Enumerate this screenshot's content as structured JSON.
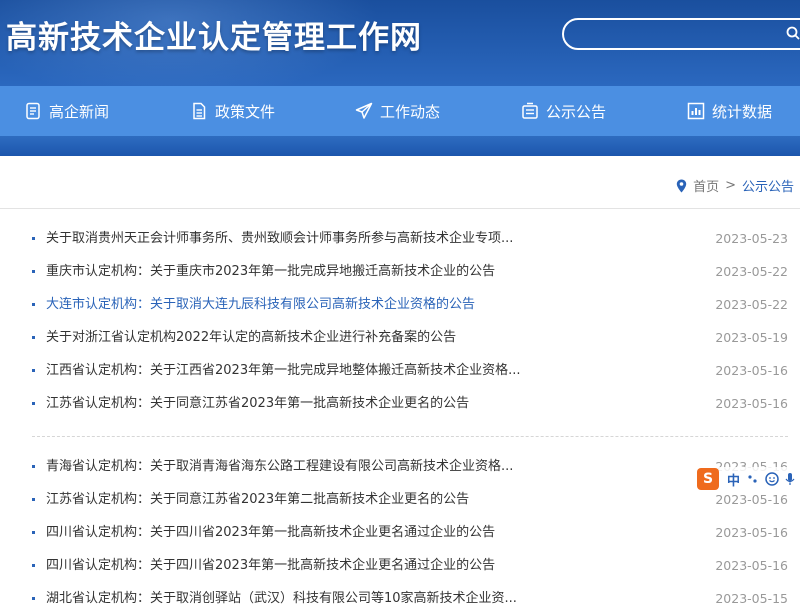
{
  "header": {
    "site_title": "高新技术企业认定管理工作网",
    "search_placeholder": ""
  },
  "nav": [
    {
      "label": "高企新闻",
      "icon": "document-icon"
    },
    {
      "label": "政策文件",
      "icon": "file-list-icon"
    },
    {
      "label": "工作动态",
      "icon": "paper-plane-icon"
    },
    {
      "label": "公示公告",
      "icon": "notice-board-icon"
    },
    {
      "label": "统计数据",
      "icon": "bar-chart-icon"
    }
  ],
  "breadcrumb": {
    "home": "首页",
    "separator": ">",
    "current": "公示公告"
  },
  "notices_group1": [
    {
      "title": "关于取消贵州天正会计师事务所、贵州致顺会计师事务所参与高新技术企业专项...",
      "date": "2023-05-23"
    },
    {
      "title": "重庆市认定机构：关于重庆市2023年第一批完成异地搬迁高新技术企业的公告",
      "date": "2023-05-22"
    },
    {
      "title": "大连市认定机构：关于取消大连九辰科技有限公司高新技术企业资格的公告",
      "date": "2023-05-22"
    },
    {
      "title": "关于对浙江省认定机构2022年认定的高新技术企业进行补充备案的公告",
      "date": "2023-05-19"
    },
    {
      "title": "江西省认定机构：关于江西省2023年第一批完成异地整体搬迁高新技术企业资格...",
      "date": "2023-05-16"
    },
    {
      "title": "江苏省认定机构：关于同意江苏省2023年第一批高新技术企业更名的公告",
      "date": "2023-05-16"
    }
  ],
  "notices_group2": [
    {
      "title": "青海省认定机构：关于取消青海省海东公路工程建设有限公司高新技术企业资格...",
      "date": "2023-05-16"
    },
    {
      "title": "江苏省认定机构：关于同意江苏省2023年第二批高新技术企业更名的公告",
      "date": "2023-05-16"
    },
    {
      "title": "四川省认定机构：关于四川省2023年第一批高新技术企业更名通过企业的公告",
      "date": "2023-05-16"
    },
    {
      "title": "四川省认定机构：关于四川省2023年第一批高新技术企业更名通过企业的公告",
      "date": "2023-05-16"
    },
    {
      "title": "湖北省认定机构：关于取消创驿站（武汉）科技有限公司等10家高新技术企业资...",
      "date": "2023-05-15"
    }
  ],
  "ime_toolbar": {
    "logo": "S",
    "mode": "中"
  },
  "colors": {
    "header_bg": "#1a4f9e",
    "nav_bg": "#4b8fe2",
    "link": "#2a63b8",
    "date": "#999999"
  }
}
